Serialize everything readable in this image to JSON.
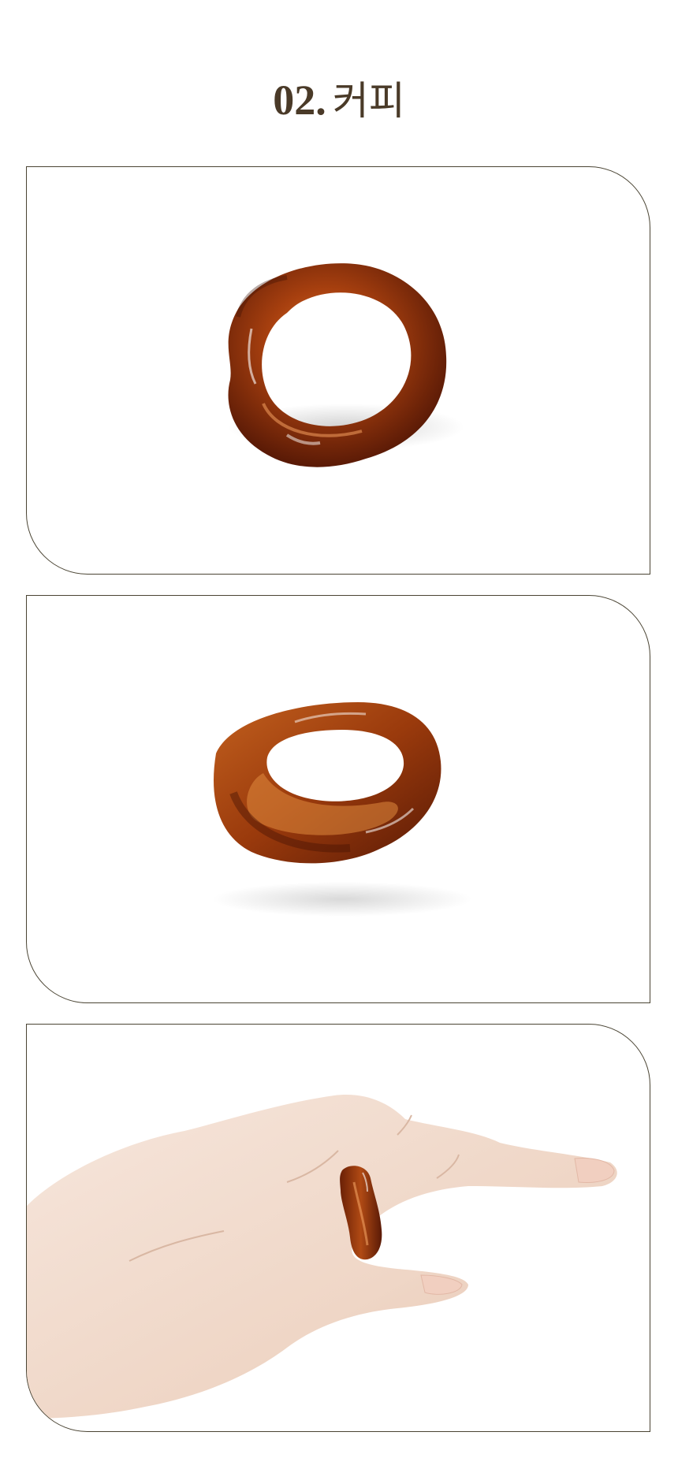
{
  "header": {
    "number": "02.",
    "color_name": "커피"
  },
  "colors": {
    "title": "#4a3a28",
    "frame_border": "#4a4433",
    "ring_amber": "#a8400f",
    "ring_dark": "#5a1a06",
    "skin": "#f2ddd0"
  },
  "cards": [
    {
      "image": "ring-top-view"
    },
    {
      "image": "ring-angled-view"
    },
    {
      "image": "ring-worn-on-hand"
    }
  ]
}
